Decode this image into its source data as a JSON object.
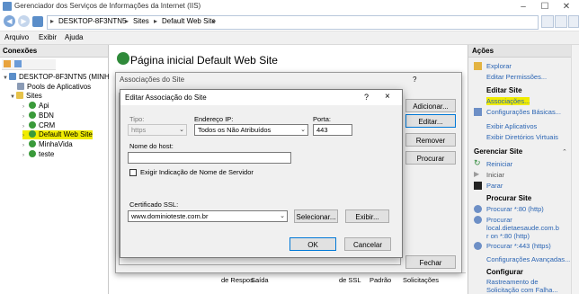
{
  "window": {
    "title": "Gerenciador dos Serviços de Informações da Internet (IIS)"
  },
  "address": {
    "crumbs": [
      "DESKTOP-8F3NTN5",
      "Sites",
      "Default Web Site"
    ]
  },
  "menu": [
    "Arquivo",
    "Exibir",
    "Ajuda"
  ],
  "connections": {
    "header": "Conexões",
    "tree": [
      {
        "label": "DESKTOP-8F3NTN5 (MINHAV",
        "level": 0,
        "expanded": true
      },
      {
        "label": "Pools de Aplicativos",
        "level": 1
      },
      {
        "label": "Sites",
        "level": 1,
        "expanded": true
      },
      {
        "label": "Api",
        "level": 2
      },
      {
        "label": "BDN",
        "level": 2
      },
      {
        "label": "CRM",
        "level": 2
      },
      {
        "label": "Default Web Site",
        "level": 2,
        "selected": true
      },
      {
        "label": "MinhaVida",
        "level": 2
      },
      {
        "label": "teste",
        "level": 2
      }
    ]
  },
  "main": {
    "title": "Página inicial Default Web Site"
  },
  "background_columns": [
    "de Respos...",
    "Saída",
    "de SSL",
    "Padrão",
    "Solicitações"
  ],
  "actions": {
    "header": "Ações",
    "explorar": "Explorar",
    "editar_permissoes": "Editar Permissões...",
    "editar_site_header": "Editar Site",
    "associacoes": "Associações...",
    "config_basicas": "Configurações Básicas...",
    "exibir_aplicativos": "Exibir Aplicativos",
    "exibir_diretorios": "Exibir Diretórios Virtuais",
    "gerenciar_header": "Gerenciar Site",
    "reiniciar": "Reiniciar",
    "iniciar": "Iniciar",
    "parar": "Parar",
    "procurar_header": "Procurar Site",
    "procurar_80": "Procurar *:80 (http)",
    "procurar_local_1": "Procurar",
    "procurar_local_2": "local.dietaesaude.com.b",
    "procurar_local_3": "r on *:80 (http)",
    "procurar_443": "Procurar *:443 (https)",
    "config_avancadas": "Configurações Avançadas...",
    "configurar_header": "Configurar",
    "rastreamento_1": "Rastreamento de",
    "rastreamento_2": "Solicitação com Falha..."
  },
  "site_bindings_dialog": {
    "title": "Associações do Site",
    "help": "?",
    "add": "Adicionar...",
    "edit": "Editar...",
    "remove": "Remover",
    "browse": "Procurar",
    "close": "Fechar"
  },
  "edit_binding_dialog": {
    "title": "Editar Associação do Site",
    "help": "?",
    "close": "×",
    "tipo_label": "Tipo:",
    "tipo_value": "https",
    "ip_label": "Endereço IP:",
    "ip_value": "Todos os Não Atribuídos",
    "porta_label": "Porta:",
    "porta_value": "443",
    "host_label": "Nome do host:",
    "host_value": "",
    "sni_label": "Exigir Indicação de Nome de Servidor",
    "sni_checked": false,
    "cert_label": "Certificado SSL:",
    "cert_value": "www.dominioteste.com.br",
    "selecionar": "Selecionar...",
    "exibir": "Exibir...",
    "ok": "OK",
    "cancelar": "Cancelar"
  },
  "colors": {
    "accent": "#0078d7",
    "link": "#2a64b3",
    "highlight": "#f0ec00"
  }
}
